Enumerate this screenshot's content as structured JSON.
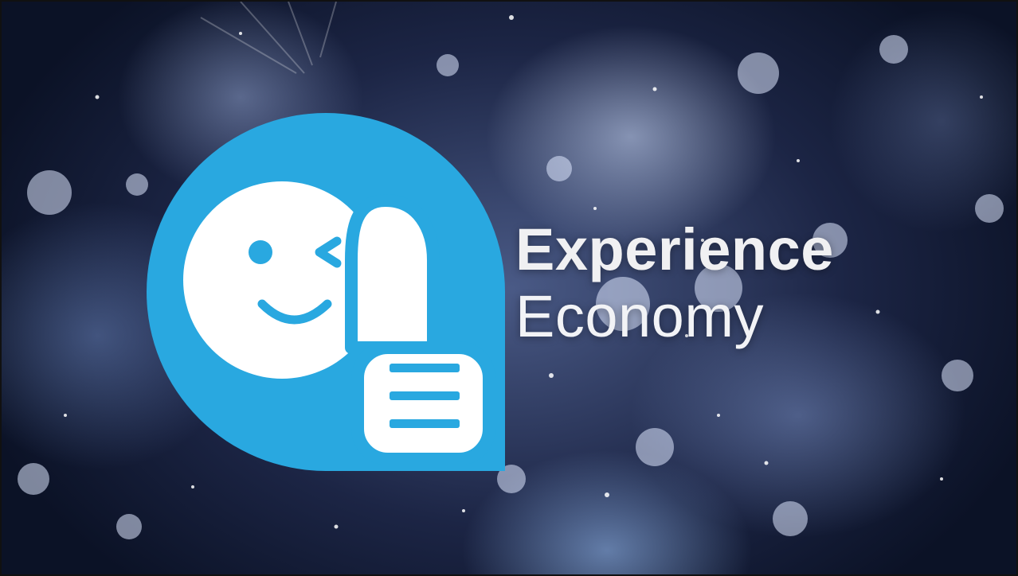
{
  "slide": {
    "title_bold": "Experience",
    "title_regular": "Economy"
  },
  "logo": {
    "icon": "winking-smiley-thumbs-up-icon",
    "bubble_color": "#29a8e0",
    "face_color": "#ffffff"
  },
  "background": {
    "description_color": "#1c2545"
  }
}
